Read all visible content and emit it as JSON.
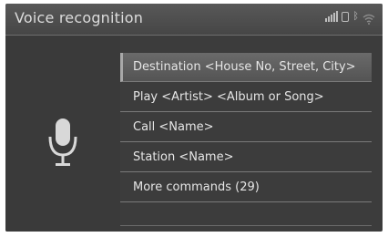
{
  "header": {
    "title": "Voice recognition"
  },
  "status_icons": [
    "signal-icon",
    "phone-battery-icon",
    "bluetooth-icon",
    "wifi-icon"
  ],
  "commands": [
    {
      "label": "Destination <House No, Street, City>"
    },
    {
      "label": "Play <Artist> <Album or Song>"
    },
    {
      "label": "Call <Name>"
    },
    {
      "label": "Station <Name>"
    },
    {
      "label": "More commands (29)"
    }
  ],
  "colors": {
    "background": "#3c3c3c",
    "highlight": "#606060",
    "text": "#e6e6e6"
  }
}
